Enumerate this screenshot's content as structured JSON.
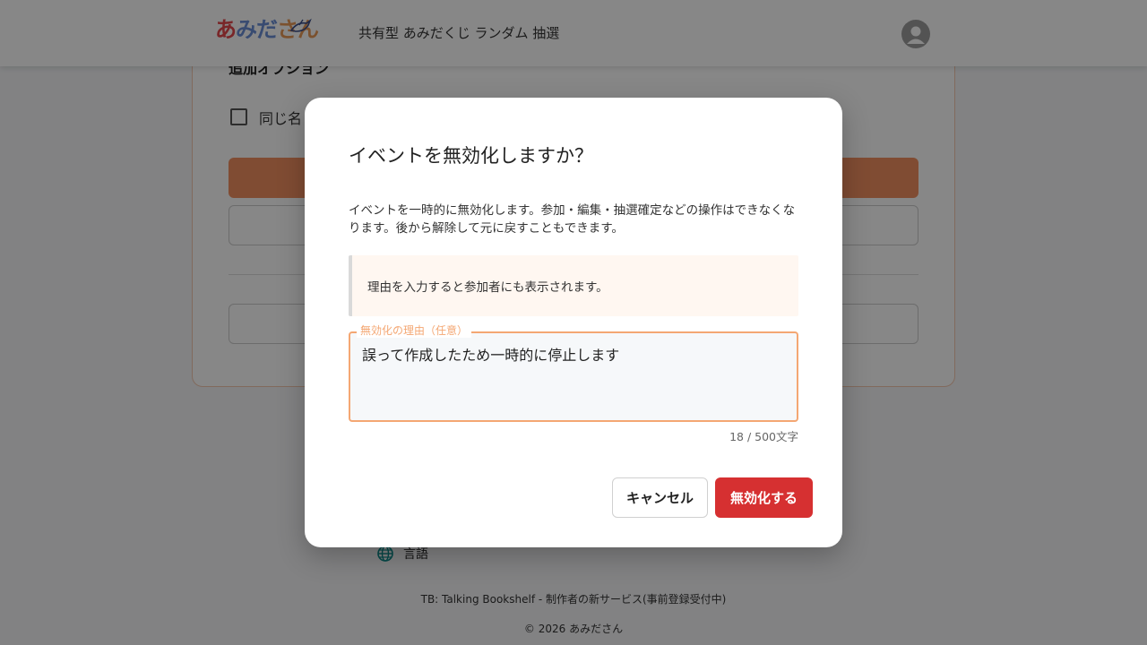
{
  "header": {
    "logo_part1": "あ",
    "logo_part2": "みだ",
    "logo_part3": "さん",
    "title": "共有型 あみだくじ ランダム 抽選"
  },
  "card": {
    "section_title": "追加オプション",
    "checkbox_label": "同じ名"
  },
  "footer": {
    "language_label": "言語",
    "promo_link": "TB: Talking Bookshelf - 制作者の新サービス(事前登録受付中)",
    "copyright": "© 2026 あみださん"
  },
  "dialog": {
    "title": "イベントを無効化しますか？",
    "description": "イベントを一時的に無効化します。参加・編集・抽選確定などの操作はできなくなります。後から解除して元に戻すこともできます。",
    "note": "理由を入力すると参加者にも表示されます。",
    "reason_label": "無効化の理由（任意）",
    "reason_value": "誤って作成したため一時的に停止します",
    "char_count": "18 / 500文字",
    "cancel_label": "キャンセル",
    "confirm_label": "無効化する"
  },
  "colors": {
    "accent": "#f29061",
    "danger": "#d63031",
    "focus_border": "#f4a773"
  },
  "icons": {
    "avatar": "account-circle-icon",
    "language": "globe-icon",
    "logo_mark": "bird-icon"
  }
}
